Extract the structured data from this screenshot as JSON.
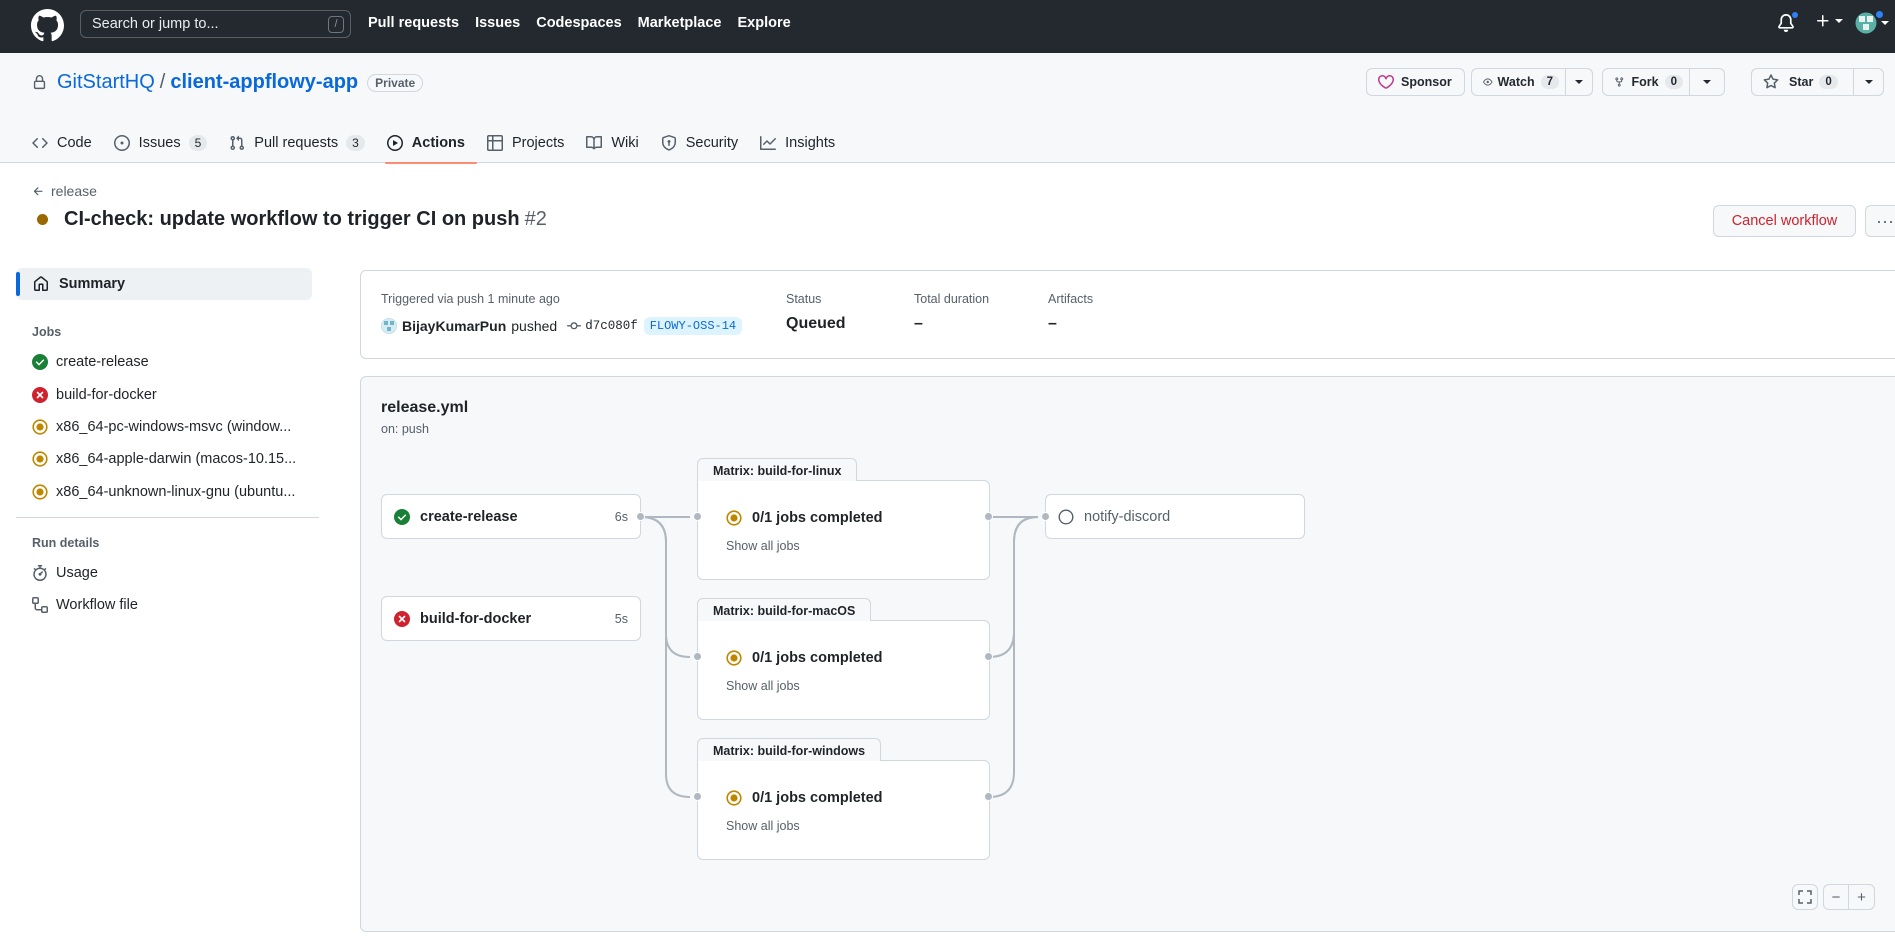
{
  "header": {
    "search_placeholder": "Search or jump to...",
    "search_key": "/",
    "nav": [
      "Pull requests",
      "Issues",
      "Codespaces",
      "Marketplace",
      "Explore"
    ]
  },
  "repo": {
    "owner": "GitStartHQ",
    "separator": "/",
    "name": "client-appflowy-app",
    "visibility": "Private",
    "sponsor_label": "Sponsor",
    "watch_label": "Watch",
    "watch_count": "7",
    "fork_label": "Fork",
    "fork_count": "0",
    "star_label": "Star",
    "star_count": "0",
    "tabs": [
      {
        "label": "Code",
        "count": ""
      },
      {
        "label": "Issues",
        "count": "5"
      },
      {
        "label": "Pull requests",
        "count": "3"
      },
      {
        "label": "Actions",
        "count": ""
      },
      {
        "label": "Projects",
        "count": ""
      },
      {
        "label": "Wiki",
        "count": ""
      },
      {
        "label": "Security",
        "count": ""
      },
      {
        "label": "Insights",
        "count": ""
      }
    ]
  },
  "run": {
    "back_label": "release",
    "title": "CI-check: update workflow to trigger CI on push",
    "number": "#2",
    "cancel_label": "Cancel workflow",
    "more_label": "···"
  },
  "sidebar": {
    "summary_label": "Summary",
    "jobs_heading": "Jobs",
    "jobs": [
      {
        "label": "create-release",
        "status": "success"
      },
      {
        "label": "build-for-docker",
        "status": "failure"
      },
      {
        "label": "x86_64-pc-windows-msvc (window...",
        "status": "queued"
      },
      {
        "label": "x86_64-apple-darwin (macos-10.15...",
        "status": "queued"
      },
      {
        "label": "x86_64-unknown-linux-gnu (ubuntu...",
        "status": "queued"
      }
    ],
    "run_details_heading": "Run details",
    "usage_label": "Usage",
    "workflow_file_label": "Workflow file"
  },
  "summary": {
    "triggered_label": "Triggered via push 1 minute ago",
    "actor": "BijayKumarPun",
    "action": "pushed",
    "commit": "d7c080f",
    "branch": "FLOWY-OSS-14",
    "status_label": "Status",
    "status_value": "Queued",
    "duration_label": "Total duration",
    "duration_value": "–",
    "artifacts_label": "Artifacts",
    "artifacts_value": "–"
  },
  "graph": {
    "workflow_file": "release.yml",
    "trigger": "on: push",
    "jobs": [
      {
        "label": "create-release",
        "duration": "6s",
        "status": "success"
      },
      {
        "label": "build-for-docker",
        "duration": "5s",
        "status": "failure"
      }
    ],
    "matrices": [
      {
        "title": "Matrix: build-for-linux",
        "progress": "0/1 jobs completed",
        "show_all": "Show all jobs"
      },
      {
        "title": "Matrix: build-for-macOS",
        "progress": "0/1 jobs completed",
        "show_all": "Show all jobs"
      },
      {
        "title": "Matrix: build-for-windows",
        "progress": "0/1 jobs completed",
        "show_all": "Show all jobs"
      }
    ],
    "notify": {
      "label": "notify-discord",
      "status": "pending"
    },
    "zoom_out": "−",
    "zoom_in": "+"
  },
  "colors": {
    "header_bg": "#24292f",
    "link": "#0969da",
    "success": "#1a7f37",
    "failure": "#cf222e",
    "queued": "#bf8700",
    "active_tab_underline": "#fd8c73"
  }
}
